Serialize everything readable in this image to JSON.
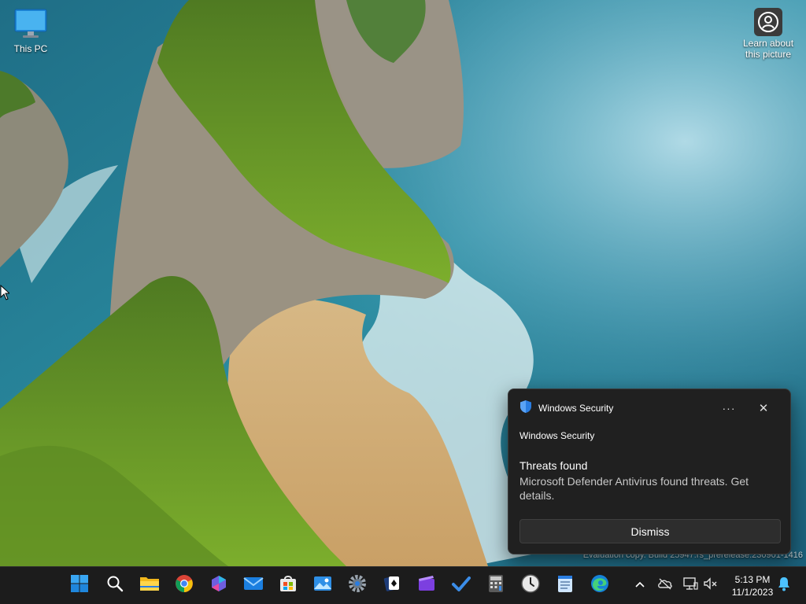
{
  "desktop": {
    "icons": [
      {
        "label": "This PC"
      },
      {
        "label": "Learn about this picture"
      }
    ],
    "watermark": "Evaluation copy. Build 25947.rs_prerelease.230901-1416"
  },
  "toast": {
    "app_name": "Windows Security",
    "more_glyph": "···",
    "close_glyph": "✕",
    "subtitle": "Windows Security",
    "title": "Threats found",
    "body": "Microsoft Defender Antivirus found threats. Get details.",
    "dismiss_label": "Dismiss"
  },
  "taskbar": {
    "apps": [
      {
        "name": "Start",
        "icon": "windows-logo-icon"
      },
      {
        "name": "Search",
        "icon": "search-icon"
      },
      {
        "name": "File Explorer",
        "icon": "folder-icon"
      },
      {
        "name": "Google Chrome",
        "icon": "chrome-icon"
      },
      {
        "name": "Copilot",
        "icon": "copilot-icon"
      },
      {
        "name": "Mail",
        "icon": "mail-icon"
      },
      {
        "name": "Microsoft Store",
        "icon": "store-icon"
      },
      {
        "name": "Photos",
        "icon": "photos-icon"
      },
      {
        "name": "Settings",
        "icon": "gear-icon"
      },
      {
        "name": "Solitaire",
        "icon": "cards-icon"
      },
      {
        "name": "Clipchamp",
        "icon": "clipchamp-icon"
      },
      {
        "name": "To Do",
        "icon": "todo-check-icon"
      },
      {
        "name": "Calculator",
        "icon": "calculator-icon"
      },
      {
        "name": "Clock",
        "icon": "clock-icon"
      },
      {
        "name": "Notepad",
        "icon": "notepad-icon"
      },
      {
        "name": "Microsoft Edge",
        "icon": "edge-icon"
      }
    ],
    "clock": {
      "time": "5:13 PM",
      "date": "11/1/2023"
    }
  },
  "colors": {
    "taskbar_bg": "#1c1c1c",
    "toast_bg": "#202020",
    "accent": "#0078d4"
  }
}
